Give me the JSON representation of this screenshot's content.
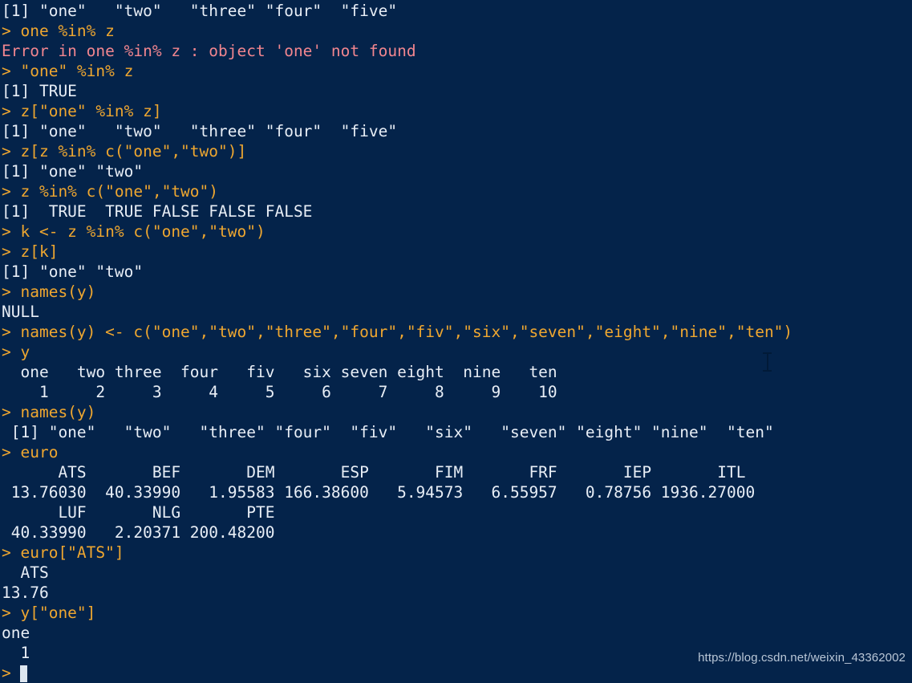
{
  "terminal": {
    "app": "R Console",
    "colors": {
      "background": "#04234a",
      "output_text": "#e8eef6",
      "input_text": "#efa730",
      "error_text": "#f2868f",
      "cursor": "#dde6f0"
    },
    "lines": [
      {
        "kind": "output",
        "text": "[1] \"one\"   \"two\"   \"three\" \"four\"  \"five\""
      },
      {
        "kind": "input",
        "text": "> one %in% z"
      },
      {
        "kind": "error",
        "text": "Error in one %in% z : object 'one' not found"
      },
      {
        "kind": "input",
        "text": "> \"one\" %in% z"
      },
      {
        "kind": "output",
        "text": "[1] TRUE"
      },
      {
        "kind": "input",
        "text": "> z[\"one\" %in% z]"
      },
      {
        "kind": "output",
        "text": "[1] \"one\"   \"two\"   \"three\" \"four\"  \"five\""
      },
      {
        "kind": "input",
        "text": "> z[z %in% c(\"one\",\"two\")]"
      },
      {
        "kind": "output",
        "text": "[1] \"one\" \"two\""
      },
      {
        "kind": "input",
        "text": "> z %in% c(\"one\",\"two\")"
      },
      {
        "kind": "output",
        "text": "[1]  TRUE  TRUE FALSE FALSE FALSE"
      },
      {
        "kind": "input",
        "text": "> k <- z %in% c(\"one\",\"two\")"
      },
      {
        "kind": "input",
        "text": "> z[k]"
      },
      {
        "kind": "output",
        "text": "[1] \"one\" \"two\""
      },
      {
        "kind": "input",
        "text": "> names(y)"
      },
      {
        "kind": "output",
        "text": "NULL"
      },
      {
        "kind": "input",
        "text": "> names(y) <- c(\"one\",\"two\",\"three\",\"four\",\"fiv\",\"six\",\"seven\",\"eight\",\"nine\",\"ten\")"
      },
      {
        "kind": "input",
        "text": "> y"
      },
      {
        "kind": "output",
        "text": "  one   two three  four   fiv   six seven eight  nine   ten"
      },
      {
        "kind": "output",
        "text": "    1     2     3     4     5     6     7     8     9    10"
      },
      {
        "kind": "input",
        "text": "> names(y)"
      },
      {
        "kind": "output",
        "text": " [1] \"one\"   \"two\"   \"three\" \"four\"  \"fiv\"   \"six\"   \"seven\" \"eight\" \"nine\"  \"ten\""
      },
      {
        "kind": "input",
        "text": "> euro"
      },
      {
        "kind": "output",
        "text": "      ATS       BEF       DEM       ESP       FIM       FRF       IEP       ITL"
      },
      {
        "kind": "output",
        "text": " 13.76030  40.33990   1.95583 166.38600   5.94573   6.55957   0.78756 1936.27000"
      },
      {
        "kind": "output",
        "text": "      LUF       NLG       PTE"
      },
      {
        "kind": "output",
        "text": " 40.33990   2.20371 200.48200"
      },
      {
        "kind": "input",
        "text": "> euro[\"ATS\"]"
      },
      {
        "kind": "output",
        "text": "  ATS"
      },
      {
        "kind": "output",
        "text": "13.76"
      },
      {
        "kind": "input",
        "text": "> y[\"one\"]"
      },
      {
        "kind": "output",
        "text": "one"
      },
      {
        "kind": "output",
        "text": "  1"
      },
      {
        "kind": "input",
        "text": "> "
      }
    ]
  },
  "watermark": {
    "text": "https://blog.csdn.net/weixin_43362002"
  }
}
